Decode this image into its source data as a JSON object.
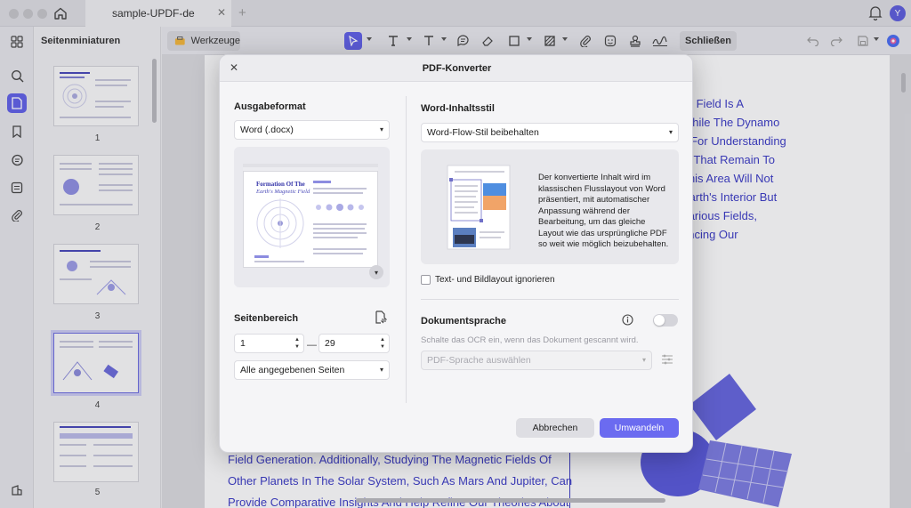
{
  "window": {
    "tab_title": "sample-UPDF-de",
    "avatar_letter": "Y"
  },
  "thumbnails": {
    "title": "Seitenminiaturen",
    "pages": [
      "1",
      "2",
      "3",
      "4",
      "5"
    ],
    "selected_page": "4"
  },
  "toolbar": {
    "tools_label": "Werkzeuge",
    "close_label": "Schließen"
  },
  "document": {
    "right_column": [
      "tic Field Is A",
      "While The Dynamo",
      "k For Understanding",
      "ts That Remain To",
      "This Area Will Not",
      "Earth's Interior But",
      "Various Fields,",
      "ancing Our"
    ],
    "bottom_lines": [
      "Field Generation. Additionally, Studying The Magnetic Fields Of",
      "Other Planets In The Solar System, Such As Mars And Jupiter, Can",
      "Provide Comparative Insights And Help Refine Our Theories About"
    ]
  },
  "dialog": {
    "title": "PDF-Konverter",
    "output_format_label": "Ausgabeformat",
    "output_format_value": "Word (.docx)",
    "preview_title_line1": "Formation Of The",
    "preview_title_line2": "Earth's Magnetic Field",
    "page_range_label": "Seitenbereich",
    "page_from": "1",
    "page_to": "29",
    "range_dash": "—",
    "page_subset_value": "Alle angegebenen Seiten",
    "content_style_label": "Word-Inhaltsstil",
    "content_style_value": "Word-Flow-Stil beibehalten",
    "content_style_description": "Der konvertierte Inhalt wird im klassischen Flusslayout von Word präsentiert, mit automatischer Anpassung während der Bearbeitung, um das gleiche Layout wie das ursprüngliche PDF so weit wie möglich beizubehalten.",
    "ignore_layout_label": "Text- und Bildlayout ignorieren",
    "doc_language_label": "Dokumentsprache",
    "ocr_hint": "Schalte das OCR ein, wenn das Dokument gescannt wird.",
    "language_placeholder": "PDF-Sprache auswählen",
    "cancel_label": "Abbrechen",
    "convert_label": "Umwandeln"
  },
  "colors": {
    "accent": "#6060e6",
    "primary_button": "#6b6bf0",
    "doc_text": "#3b3bc4"
  }
}
